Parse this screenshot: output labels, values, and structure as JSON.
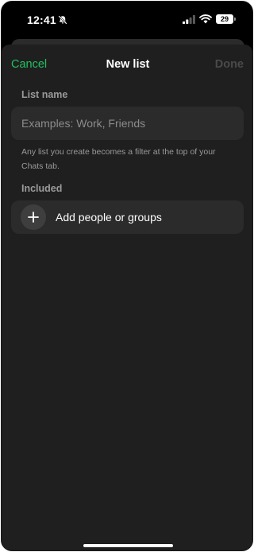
{
  "status_bar": {
    "time": "12:41",
    "battery_level": "29",
    "icons": [
      "bell-slash-icon",
      "cellular-signal-icon",
      "wifi-icon",
      "battery-icon"
    ]
  },
  "nav": {
    "cancel_label": "Cancel",
    "title": "New list",
    "done_label": "Done"
  },
  "form": {
    "list_name_label": "List name",
    "list_name_value": "",
    "list_name_placeholder": "Examples: Work, Friends",
    "helper_text": "Any list you create becomes a filter at the top of your Chats tab.",
    "included_label": "Included",
    "add_label": "Add people or groups",
    "add_icon": "plus-icon"
  },
  "colors": {
    "accent": "#21c063",
    "sheet_background": "#1f1f1f",
    "field_background": "#2b2b2b",
    "disabled_text": "#4a4a4a",
    "secondary_text": "#9a9a9a"
  }
}
